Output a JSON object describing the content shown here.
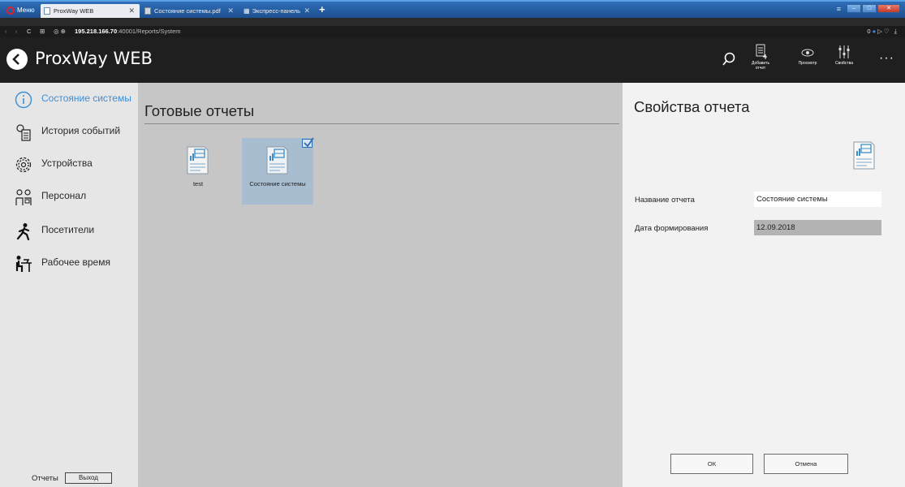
{
  "browser": {
    "menu_label": "Меню",
    "tabs": [
      {
        "label": "ProxWay WEB",
        "active": true
      },
      {
        "label": "Состояние системы.pdf",
        "active": false
      },
      {
        "label": "Экспресс-панель",
        "active": false
      }
    ],
    "new_tab": "+",
    "url_host": "195.218.166.70",
    "url_path": ":40001/Reports/System",
    "right_status": "0"
  },
  "header": {
    "app_title": "ProxWay WEB",
    "add_report_label": "Добавить отчет",
    "view_label": "Просмотр",
    "properties_label": "Свойства",
    "more": "···"
  },
  "sidebar": {
    "items": [
      {
        "label": "Состояние системы",
        "icon": "info-icon",
        "active": true
      },
      {
        "label": "История событий",
        "icon": "event-history-icon",
        "active": false
      },
      {
        "label": "Устройства",
        "icon": "gears-icon",
        "active": false
      },
      {
        "label": "Персонал",
        "icon": "staff-icon",
        "active": false
      },
      {
        "label": "Посетители",
        "icon": "walking-person-icon",
        "active": false
      },
      {
        "label": "Рабочее время",
        "icon": "desk-worker-icon",
        "active": false
      }
    ],
    "footer_label": "Отчеты",
    "logout_label": "Выход"
  },
  "main": {
    "title": "Готовые отчеты",
    "reports": [
      {
        "name": "test",
        "selected": false
      },
      {
        "name": "Состояние системы",
        "selected": true
      }
    ]
  },
  "properties": {
    "title": "Свойства отчета",
    "name_label": "Название отчета",
    "name_value": "Состояние системы",
    "date_label": "Дата формирования",
    "date_value": "12.09.2018",
    "ok_label": "ОК",
    "cancel_label": "Отмена"
  },
  "colors": {
    "accent": "#3d8fd6",
    "header_bg": "#1f1f1f",
    "sidebar_bg": "#e6e6e6",
    "main_bg": "#c6c6c6",
    "selected_tile": "#a9bdd0"
  }
}
